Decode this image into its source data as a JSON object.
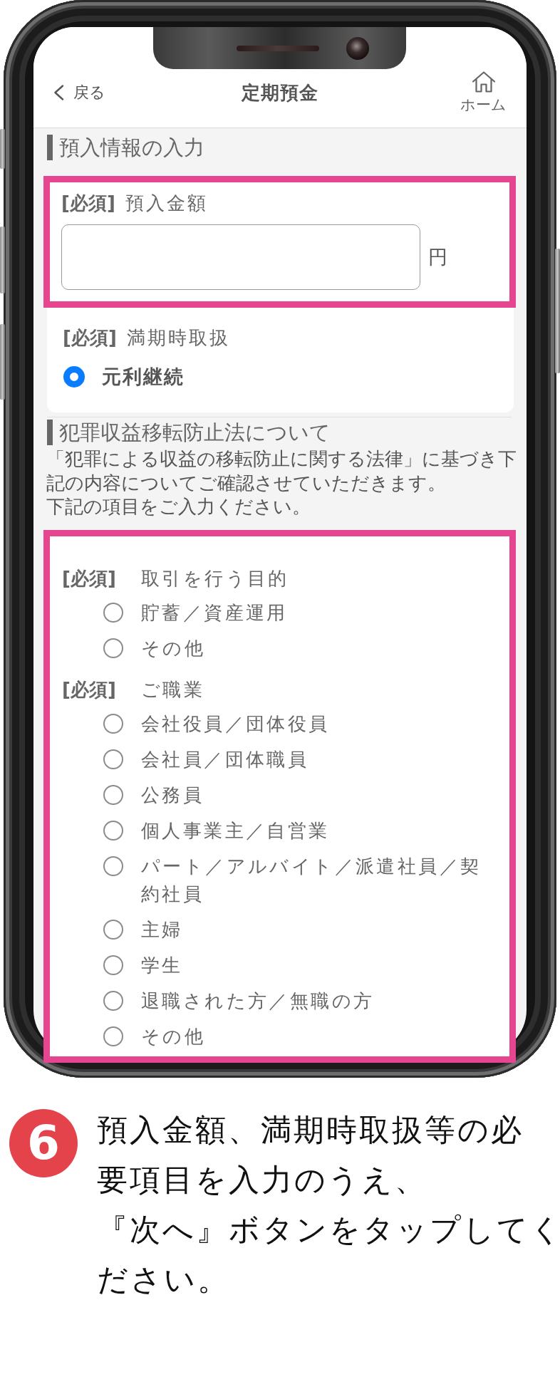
{
  "header": {
    "back": "戻る",
    "title": "定期預金",
    "home": "ホーム"
  },
  "deposit_section": {
    "title": "預入情報の入力",
    "amount": {
      "highlighted": true,
      "required": "[必須]",
      "label": "預入金額",
      "unit": "円"
    },
    "maturity": {
      "required": "[必須]",
      "label": "満期時取扱",
      "options": [
        {
          "label": "元利継続",
          "selected": true
        }
      ]
    }
  },
  "aml_section": {
    "title": "犯罪収益移転防止法について",
    "notice": [
      "「犯罪による収益の移転防止に関する法律」に基づき下記の内容についてご確認させていただきます。",
      "下記の項目をご入力ください。"
    ],
    "highlighted": true,
    "questions": [
      {
        "required": "[必須]",
        "label": "取引を行う目的",
        "options": [
          {
            "label": "貯蓄／資産運用",
            "selected": false
          },
          {
            "label": "その他",
            "selected": false
          }
        ]
      },
      {
        "required": "[必須]",
        "label": "ご職業",
        "options": [
          {
            "label": "会社役員／団体役員",
            "selected": false
          },
          {
            "label": "会社員／団体職員",
            "selected": false
          },
          {
            "label": "公務員",
            "selected": false
          },
          {
            "label": "個人事業主／自営業",
            "selected": false
          },
          {
            "label": "パート／アルバイト／派遣社員／契約社員",
            "selected": false
          },
          {
            "label": "主婦",
            "selected": false
          },
          {
            "label": "学生",
            "selected": false
          },
          {
            "label": "退職された方／無職の方",
            "selected": false
          },
          {
            "label": "その他",
            "selected": false
          }
        ]
      }
    ]
  },
  "instruction": {
    "step": "6",
    "text": [
      "預入金額、満期時取扱等の必",
      "要項目を入力のうえ、",
      "『次へ』ボタンをタップしてく",
      "ださい。"
    ]
  }
}
